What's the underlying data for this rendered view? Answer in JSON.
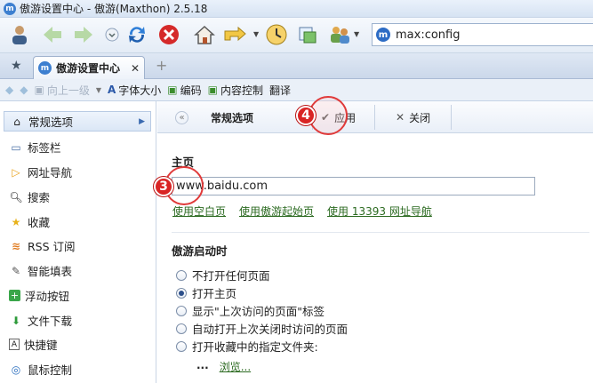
{
  "window": {
    "title": "傲游设置中心 - 傲游(Maxthon) 2.5.18"
  },
  "address_bar": {
    "url": "max:config"
  },
  "tab": {
    "label": "傲游设置中心",
    "close": "✕"
  },
  "newtab": "+",
  "navbar": {
    "up": "向上一级",
    "font_size": "字体大小",
    "encoding": "编码",
    "content_control": "内容控制",
    "translate": "翻译"
  },
  "sidebar": {
    "items": [
      {
        "label": "常规选项",
        "icon": "house-icon"
      },
      {
        "label": "标签栏",
        "icon": "tabs-icon"
      },
      {
        "label": "网址导航",
        "icon": "play-icon"
      },
      {
        "label": "搜索",
        "icon": "magnifier-icon"
      },
      {
        "label": "收藏",
        "icon": "star-icon"
      },
      {
        "label": "RSS 订阅",
        "icon": "rss-icon"
      },
      {
        "label": "智能填表",
        "icon": "pen-icon"
      },
      {
        "label": "浮动按钮",
        "icon": "plus-icon"
      },
      {
        "label": "文件下载",
        "icon": "download-icon"
      },
      {
        "label": "快捷键",
        "icon": "keyboard-icon"
      },
      {
        "label": "鼠标控制",
        "icon": "mouse-icon"
      }
    ]
  },
  "content_bar": {
    "collapse": "«",
    "title": "常规选项",
    "apply": "应用",
    "close": "关闭"
  },
  "home": {
    "heading": "主页",
    "value": "www.baidu.com",
    "links": [
      "使用空白页",
      "使用傲游起始页",
      "使用 13393 网址导航"
    ]
  },
  "startup": {
    "heading": "傲游启动时",
    "options": [
      {
        "label": "不打开任何页面",
        "selected": false
      },
      {
        "label": "打开主页",
        "selected": true
      },
      {
        "label": "显示\"上次访问的页面\"标签",
        "selected": false
      },
      {
        "label": "自动打开上次关闭时访问的页面",
        "selected": false
      },
      {
        "label": "打开收藏中的指定文件夹:",
        "selected": false
      }
    ],
    "folder_value": "...",
    "browse": "浏览..."
  },
  "annotations": {
    "badge3": "3",
    "badge4": "4"
  },
  "colors": {
    "accent": "#2d6cc5",
    "link": "#2b6a20",
    "callout": "#e03a3a"
  }
}
